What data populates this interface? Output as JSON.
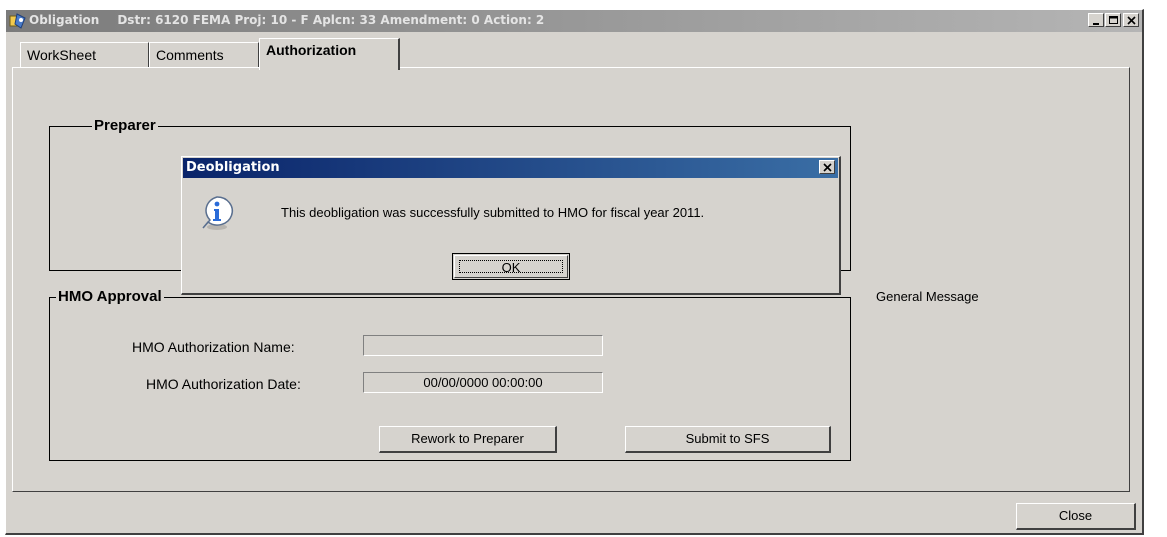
{
  "window": {
    "title": "Obligation",
    "meta": "Dstr: 6120  FEMA Proj: 10 - F  Aplcn: 33  Amendment: 0  Action: 2",
    "icon": "app-icon"
  },
  "tabs": [
    {
      "label": "WorkSheet",
      "active": false
    },
    {
      "label": "Comments",
      "active": false
    },
    {
      "label": "Authorization",
      "active": true
    }
  ],
  "preparer": {
    "label": "Preparer"
  },
  "hmo": {
    "label": "HMO Approval",
    "name_label": "HMO Authorization Name:",
    "name_value": "",
    "date_label": "HMO Authorization Date:",
    "date_value": "00/00/0000 00:00:00",
    "rework_button": "Rework to Preparer",
    "submit_button": "Submit to SFS"
  },
  "general_message": "General Message",
  "close_button": "Close",
  "dialog": {
    "title": "Deobligation",
    "icon": "info-icon",
    "message": "This deobligation was successfully submitted to HMO for fiscal year 2011.",
    "ok_label": "OK"
  },
  "colors": {
    "window_bg": "#d6d3ce",
    "dialog_title": "#0a246a",
    "inactive_title": "#7b7b7b",
    "info_blue": "#2a6bd8"
  }
}
